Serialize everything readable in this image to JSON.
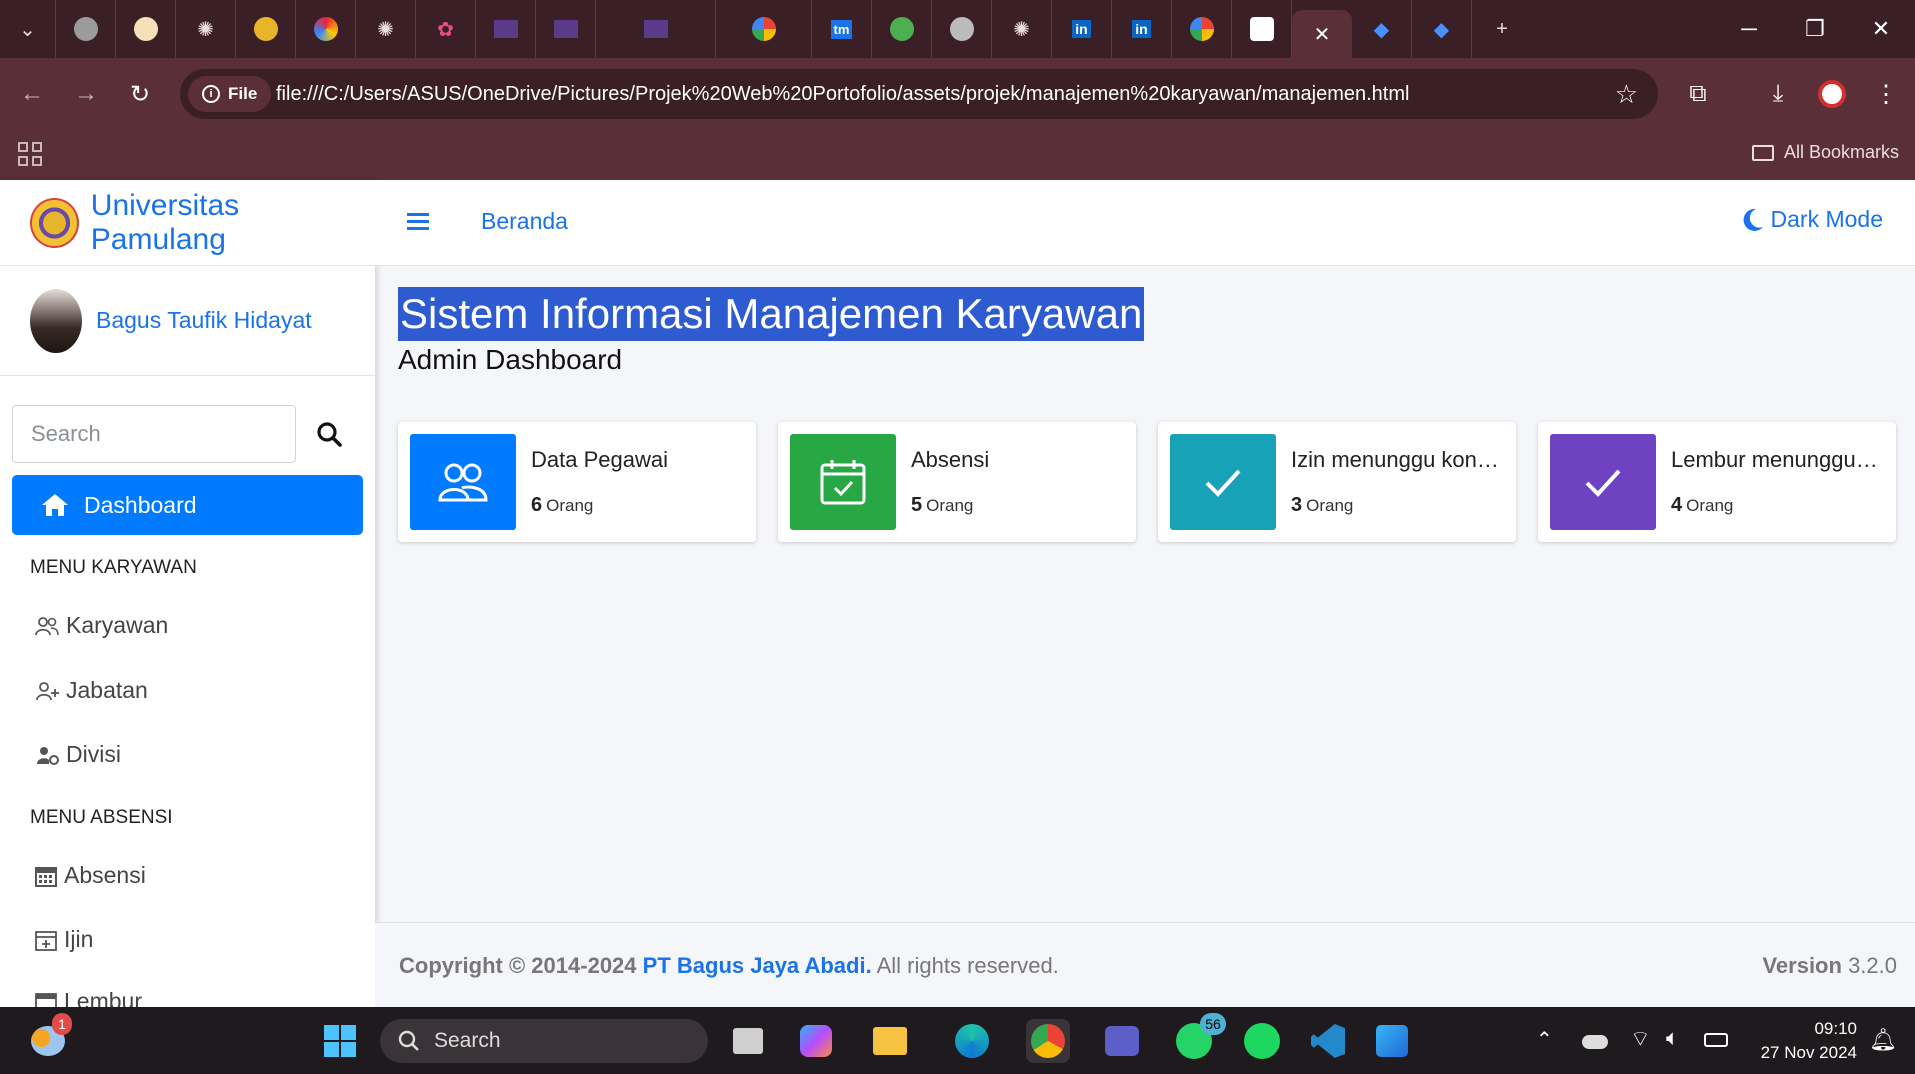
{
  "browser": {
    "active_tab_close": "✕",
    "new_tab": "+",
    "file_chip": "File",
    "url": "file:///C:/Users/ASUS/OneDrive/Pictures/Projek%20Web%20Portofolio/assets/projek/manajemen%20karyawan/manajemen.html",
    "all_bookmarks": "All Bookmarks"
  },
  "sidebar": {
    "brand": "Universitas Pamulang",
    "user_name": "Bagus Taufik Hidayat",
    "search_placeholder": "Search",
    "dashboard": "Dashboard",
    "menu_karyawan_header": "MENU KARYAWAN",
    "items_karyawan": [
      "Karyawan",
      "Jabatan",
      "Divisi"
    ],
    "menu_absensi_header": "MENU ABSENSI",
    "items_absensi": [
      "Absensi",
      "Ijin",
      "Lembur"
    ]
  },
  "topnav": {
    "breadcrumb_home": "Beranda",
    "dark_mode": "Dark Mode"
  },
  "page": {
    "title": "Sistem Informasi Manajemen Karyawan",
    "subtitle": "Admin Dashboard"
  },
  "info_boxes": [
    {
      "label": "Data Pegawai",
      "count": "6",
      "unit": "Orang",
      "color": "#007bff",
      "icon": "users-icon"
    },
    {
      "label": "Absensi",
      "count": "5",
      "unit": "Orang",
      "color": "#28a745",
      "icon": "calendar-check-icon"
    },
    {
      "label": "Izin menunggu konfirmasi",
      "count": "3",
      "unit": "Orang",
      "color": "#17a2b8",
      "icon": "check-icon"
    },
    {
      "label": "Lembur menunggu konfirmasi",
      "count": "4",
      "unit": "Orang",
      "color": "#6f42c1",
      "icon": "check-icon"
    }
  ],
  "footer": {
    "copyright": "Copyright © 2014-2024",
    "company": "PT Bagus Jaya Abadi.",
    "rights": "All rights reserved.",
    "version_label": "Version",
    "version": "3.2.0"
  },
  "taskbar": {
    "search": "Search",
    "time": "09:10",
    "date": "27 Nov 2024",
    "whatsapp_badge": "56",
    "weather_badge": "1"
  }
}
